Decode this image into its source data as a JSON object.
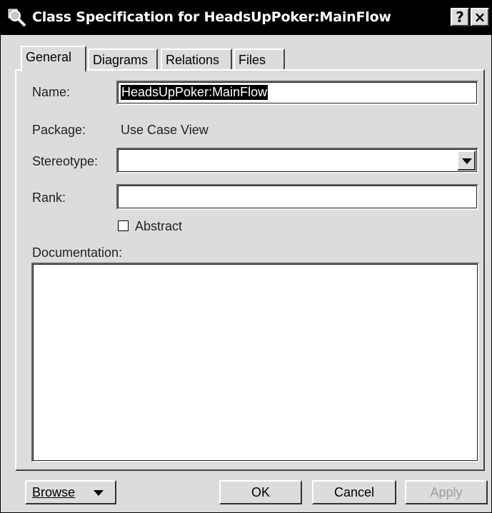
{
  "window": {
    "title": "Class Specification for HeadsUpPoker:MainFlow",
    "help_label": "?",
    "close_label": "×"
  },
  "tabs": [
    {
      "label": "General",
      "active": true
    },
    {
      "label": "Diagrams",
      "active": false
    },
    {
      "label": "Relations",
      "active": false
    },
    {
      "label": "Files",
      "active": false
    }
  ],
  "form": {
    "name_label": "Name:",
    "name_value": "HeadsUpPoker:MainFlow",
    "package_label": "Package:",
    "package_value": "Use Case View",
    "stereotype_label": "Stereotype:",
    "stereotype_value": "",
    "rank_label": "Rank:",
    "rank_value": "",
    "abstract_label": "Abstract",
    "abstract_checked": false,
    "documentation_label": "Documentation:",
    "documentation_value": ""
  },
  "buttons": {
    "browse_label": "Browse",
    "ok_label": "OK",
    "cancel_label": "Cancel",
    "apply_label": "Apply"
  }
}
